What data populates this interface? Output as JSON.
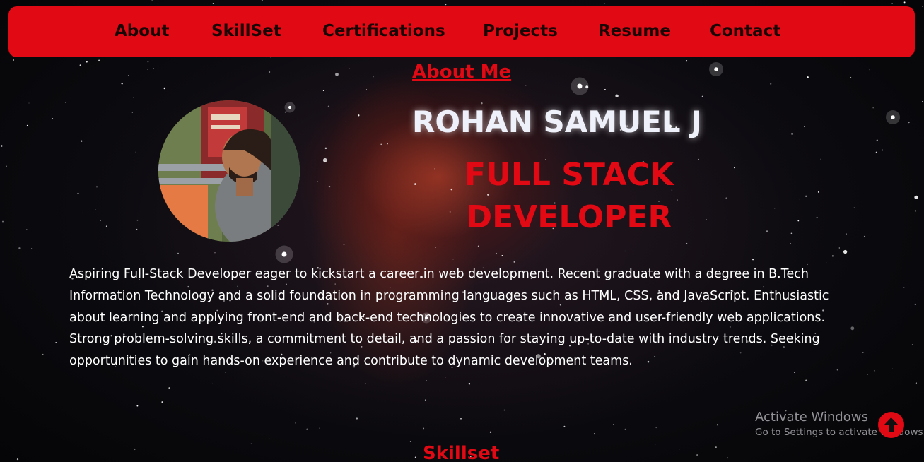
{
  "nav": {
    "items": [
      {
        "label": "About"
      },
      {
        "label": "SkillSet"
      },
      {
        "label": "Certifications"
      },
      {
        "label": "Projects"
      },
      {
        "label": "Resume"
      },
      {
        "label": "Contact"
      }
    ]
  },
  "about": {
    "section_title": "About Me",
    "name": "ROHAN SAMUEL J",
    "role_line1": "FULL STACK",
    "role_line2": "DEVELOPER",
    "bio": "Aspiring Full-Stack Developer eager to kickstart a career in web development. Recent graduate with a degree in B.Tech Information Technology and a solid foundation in programming languages such as HTML, CSS, and JavaScript. Enthusiastic about learning and applying front-end and back-end technologies to create innovative and user-friendly web applications. Strong problem-solving skills, a commitment to detail, and a passion for staying up-to-date with industry trends. Seeking opportunities to gain hands-on experience and contribute to dynamic development teams."
  },
  "skillset": {
    "section_title": "Skillset"
  },
  "watermark": {
    "title": "Activate Windows",
    "subtitle": "Go to Settings to activate Windows."
  },
  "icons": {
    "scroll_top": "arrow-up-icon"
  },
  "colors": {
    "accent": "#e10914",
    "nav_text": "#1a0606",
    "name_text": "#eef0fa",
    "body_text": "#ffffff"
  }
}
